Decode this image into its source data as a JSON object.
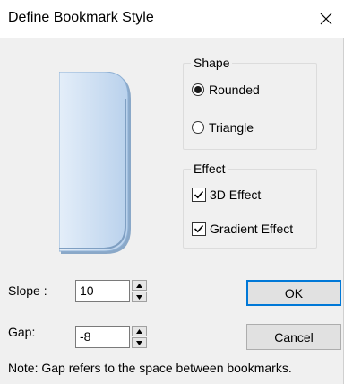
{
  "dialog": {
    "title": "Define Bookmark Style",
    "close_icon": "close-icon"
  },
  "shape_group": {
    "label": "Shape",
    "options": [
      {
        "label": "Rounded",
        "selected": true
      },
      {
        "label": "Triangle",
        "selected": false
      }
    ]
  },
  "effect_group": {
    "label": "Effect",
    "options": [
      {
        "label": "3D Effect",
        "checked": true
      },
      {
        "label": "Gradient Effect",
        "checked": true
      }
    ]
  },
  "slope": {
    "label": "Slope :",
    "value": "10"
  },
  "gap": {
    "label": "Gap:",
    "value": "-8"
  },
  "buttons": {
    "ok": "OK",
    "cancel": "Cancel"
  },
  "note": "Note: Gap refers to the space between bookmarks.",
  "colors": {
    "preview_light": "#e4eef9",
    "preview_dark": "#9fbfe0",
    "default_button_border": "#0078d7"
  }
}
